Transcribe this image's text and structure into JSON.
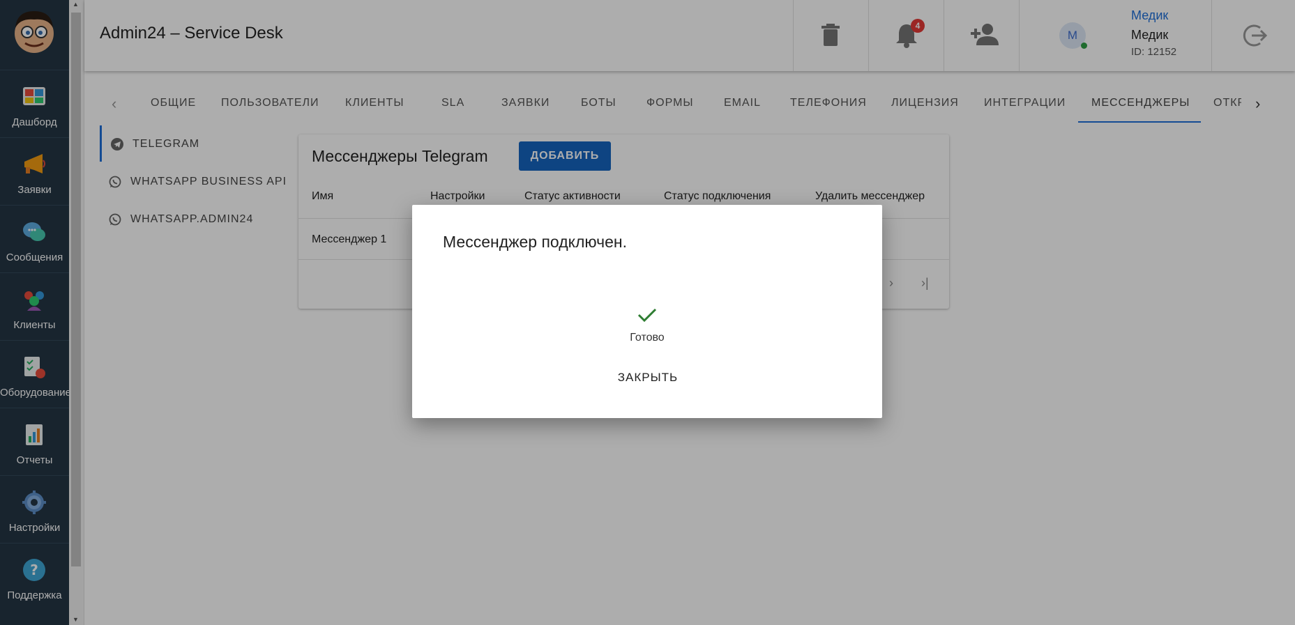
{
  "app": {
    "title": "Admin24 – Service Desk"
  },
  "sidebar": {
    "items": [
      {
        "label": "Дашборд",
        "icon": "dashboard-icon"
      },
      {
        "label": "Заявки",
        "icon": "megaphone-icon"
      },
      {
        "label": "Сообщения",
        "icon": "chat-icon"
      },
      {
        "label": "Клиенты",
        "icon": "clients-icon"
      },
      {
        "label": "Оборудование",
        "icon": "equipment-icon"
      },
      {
        "label": "Отчеты",
        "icon": "reports-icon"
      },
      {
        "label": "Настройки",
        "icon": "gear-icon"
      },
      {
        "label": "Поддержка",
        "icon": "help-icon"
      }
    ]
  },
  "header": {
    "notifications_count": "4",
    "user": {
      "initial": "M",
      "name_link": "Медик",
      "name": "Медик",
      "id": "ID: 12152"
    }
  },
  "tabs": {
    "items": [
      "ОБЩИЕ",
      "ПОЛЬЗОВАТЕЛИ",
      "КЛИЕНТЫ",
      "SLA",
      "ЗАЯВКИ",
      "БОТЫ",
      "ФОРМЫ",
      "EMAIL",
      "ТЕЛЕФОНИЯ",
      "ЛИЦЕНЗИЯ",
      "ИНТЕГРАЦИИ",
      "МЕССЕНДЖЕРЫ",
      "ОТКР"
    ],
    "active": "МЕССЕНДЖЕРЫ"
  },
  "subnav": {
    "items": [
      "TELEGRAM",
      "WHATSAPP BUSINESS API",
      "WHATSAPP.ADMIN24"
    ],
    "active": "TELEGRAM"
  },
  "card": {
    "title": "Мессенджеры Telegram",
    "add_label": "ДОБАВИТЬ",
    "columns": [
      "Имя",
      "Настройки",
      "Статус активности",
      "Статус подключения",
      "Удалить мессенджер"
    ],
    "rows": [
      [
        "Мессенджер 1"
      ]
    ]
  },
  "dialog": {
    "title": "Мессенджер подключен.",
    "status": "Готово",
    "close_label": "ЗАКРЫТЬ"
  },
  "colors": {
    "sidebar": "#243645",
    "accent": "#1565c0",
    "success": "#2e9e44",
    "badge": "#e53935"
  }
}
